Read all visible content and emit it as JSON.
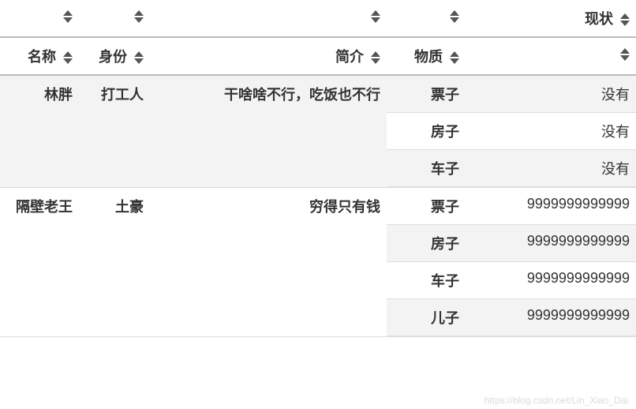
{
  "header_top": {
    "status": "现状"
  },
  "header_sub": {
    "name": "名称",
    "role": "身份",
    "intro": "简介",
    "item": "物质"
  },
  "rows": [
    {
      "name": "林胖",
      "role": "打工人",
      "intro": "干啥啥不行，吃饭也不行",
      "items": [
        {
          "label": "票子",
          "value": "没有"
        },
        {
          "label": "房子",
          "value": "没有"
        },
        {
          "label": "车子",
          "value": "没有"
        }
      ]
    },
    {
      "name": "隔壁老王",
      "role": "土豪",
      "intro": "穷得只有钱",
      "items": [
        {
          "label": "票子",
          "value": "9999999999999"
        },
        {
          "label": "房子",
          "value": "9999999999999"
        },
        {
          "label": "车子",
          "value": "9999999999999"
        },
        {
          "label": "儿子",
          "value": "9999999999999"
        }
      ]
    }
  ],
  "watermark": "https://blog.csdn.net/Lin_Xiao_Dai"
}
